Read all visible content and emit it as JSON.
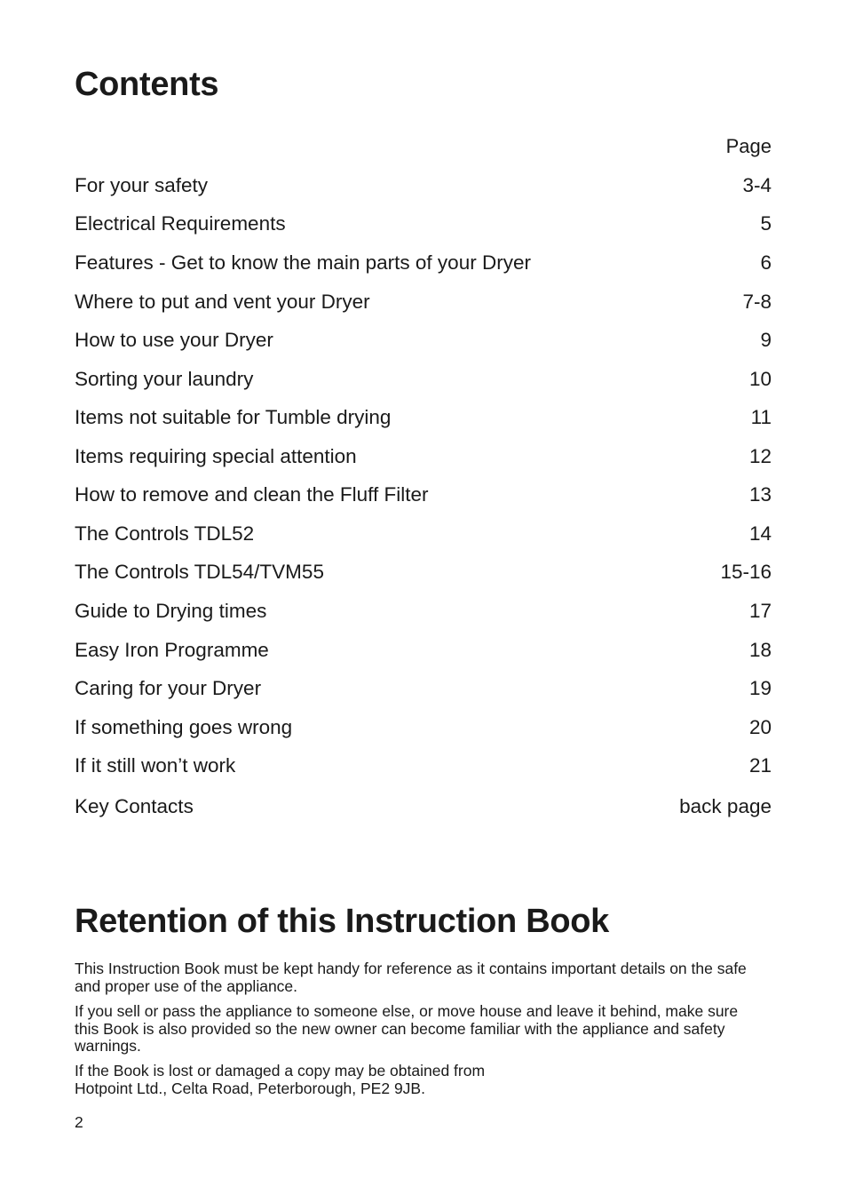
{
  "contents": {
    "title": "Contents",
    "page_header": "Page",
    "items": [
      {
        "label": "For your safety",
        "page": "3-4"
      },
      {
        "label": "Electrical Requirements",
        "page": "5"
      },
      {
        "label": "Features - Get to know the main parts of your Dryer",
        "page": "6"
      },
      {
        "label": "Where to put and vent your Dryer",
        "page": "7-8"
      },
      {
        "label": "How to use your Dryer",
        "page": "9"
      },
      {
        "label": "Sorting your laundry",
        "page": "10"
      },
      {
        "label": "Items not suitable for Tumble drying",
        "page": "11"
      },
      {
        "label": "Items requiring special attention",
        "page": "12"
      },
      {
        "label": "How to remove and clean the Fluff Filter",
        "page": "13"
      },
      {
        "label": "The Controls TDL52",
        "page": "14"
      },
      {
        "label": "The Controls TDL54/TVM55",
        "page": "15-16"
      },
      {
        "label": "Guide to Drying times",
        "page": "17"
      },
      {
        "label": "Easy Iron Programme",
        "page": "18"
      },
      {
        "label": "Caring for your Dryer",
        "page": "19"
      },
      {
        "label": "If something goes wrong",
        "page": "20"
      },
      {
        "label": "If it still won’t work",
        "page": "21"
      },
      {
        "label": "Key Contacts",
        "page": "back page"
      }
    ]
  },
  "retention": {
    "title": "Retention of this Instruction Book",
    "paragraphs": [
      "This Instruction Book must be kept handy for reference as it contains important details on the safe and proper use of the appliance.",
      "If you sell or pass the appliance to someone else, or move house and leave it behind, make sure this Book is also provided so the new owner can become familiar with the appliance and safety warnings.",
      "If the Book is lost or damaged a copy may be obtained from\nHotpoint Ltd., Celta Road, Peterborough, PE2 9JB."
    ]
  },
  "footer": {
    "page_number": "2"
  }
}
